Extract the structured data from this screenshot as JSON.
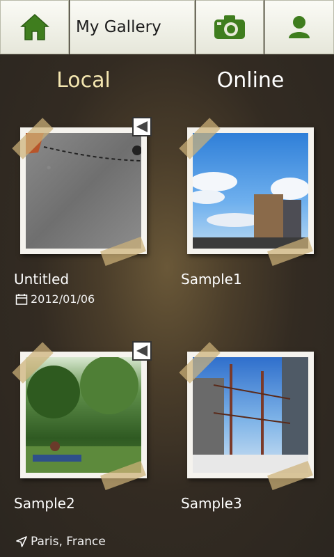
{
  "header": {
    "title": "My Gallery",
    "icons": [
      "home-icon",
      "camera-icon",
      "user-icon"
    ],
    "accent_color": "#3f7d1e"
  },
  "tabs": [
    {
      "label": "Local",
      "active": true
    },
    {
      "label": "Online",
      "active": false
    }
  ],
  "items": [
    {
      "name": "Untitled",
      "date": "2012/01/06",
      "flagged": true
    },
    {
      "name": "Sample1",
      "flagged": false
    },
    {
      "name": "Sample2",
      "flagged": true
    },
    {
      "name": "Sample3",
      "flagged": false
    }
  ],
  "footer": {
    "location": "Paris, France"
  }
}
